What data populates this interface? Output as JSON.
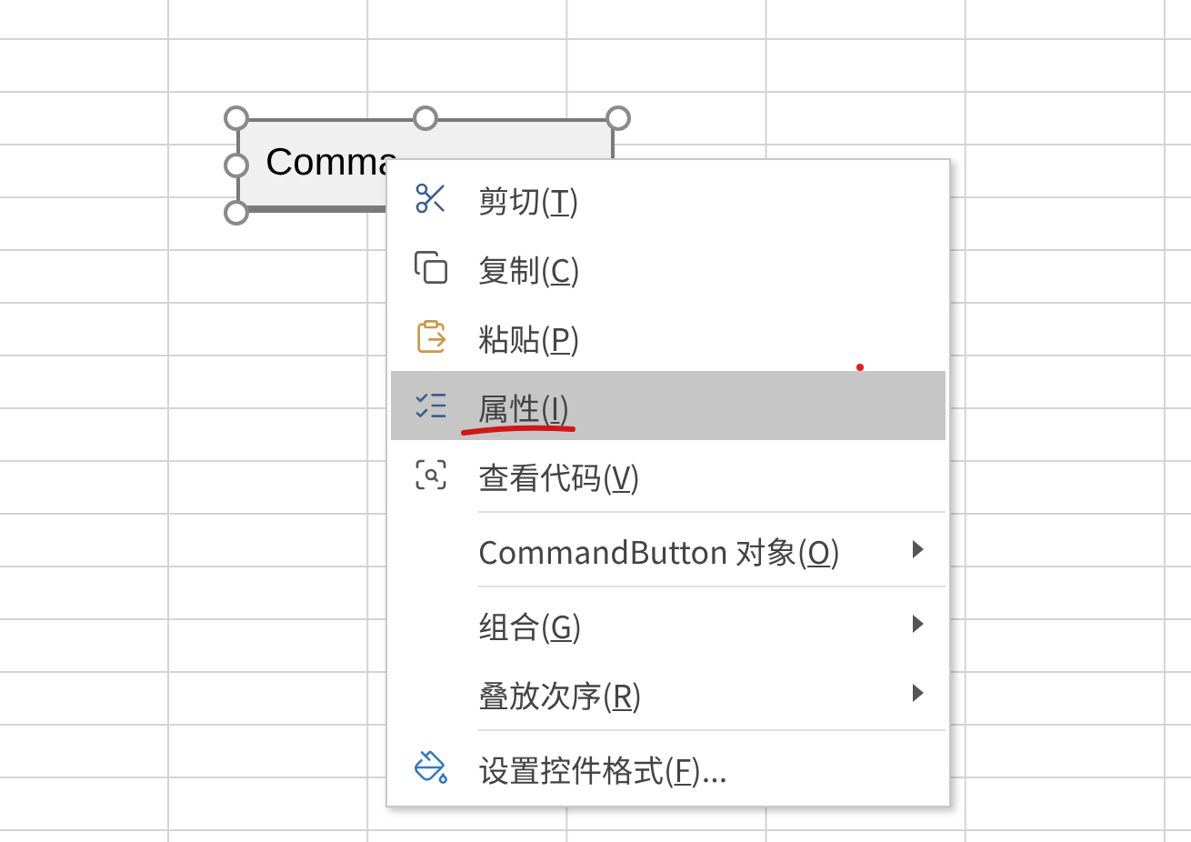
{
  "control": {
    "label": "Comma",
    "selected": true
  },
  "context_menu": {
    "items": [
      {
        "kind": "item",
        "before": "剪切(",
        "key": "T",
        "after": ")",
        "selected": false,
        "submenu": false
      },
      {
        "kind": "item",
        "before": "复制(",
        "key": "C",
        "after": ")",
        "selected": false,
        "submenu": false
      },
      {
        "kind": "item",
        "before": "粘贴(",
        "key": "P",
        "after": ")",
        "selected": false,
        "submenu": false
      },
      {
        "kind": "item",
        "before": "属性(",
        "key": "I",
        "after": ")",
        "selected": true,
        "submenu": false,
        "annotated": true
      },
      {
        "kind": "item",
        "before": "查看代码(",
        "key": "V",
        "after": ")",
        "selected": false,
        "submenu": false
      },
      {
        "kind": "separator"
      },
      {
        "kind": "item",
        "before": "CommandButton 对象(",
        "key": "O",
        "after": ")",
        "selected": false,
        "submenu": true
      },
      {
        "kind": "separator"
      },
      {
        "kind": "item",
        "before": "组合(",
        "key": "G",
        "after": ")",
        "selected": false,
        "submenu": true
      },
      {
        "kind": "item",
        "before": "叠放次序(",
        "key": "R",
        "after": ")",
        "selected": false,
        "submenu": true
      },
      {
        "kind": "separator"
      },
      {
        "kind": "item",
        "before": "设置控件格式(",
        "key": "F",
        "after": ")...",
        "selected": false,
        "submenu": false
      }
    ]
  }
}
